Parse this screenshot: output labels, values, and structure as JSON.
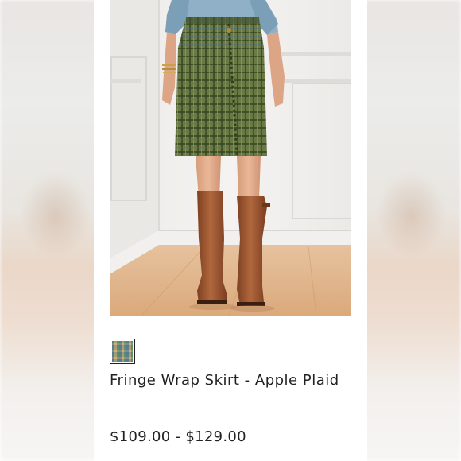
{
  "product": {
    "name": "Fringe Wrap Skirt - Apple Plaid",
    "price_range": "$109.00 - $129.00",
    "swatch_label": "Apple Plaid",
    "image_description": "Model wearing green plaid wrap skirt, chambray shirt and brown knee-high boots"
  },
  "colors": {
    "plaid_base": "#5d6b3c",
    "plaid_line": "#34451f",
    "boot": "#9a5532",
    "shirt": "#8fb0c6",
    "floor": "#e2b88c"
  }
}
